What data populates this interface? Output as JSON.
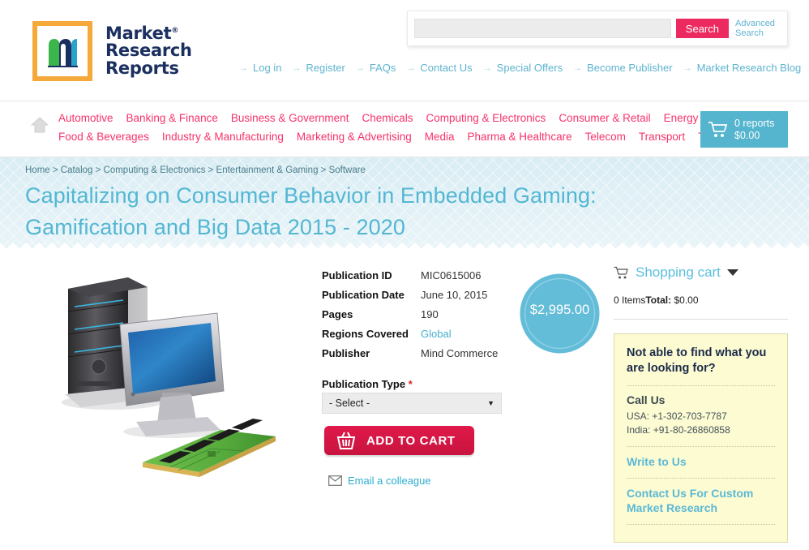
{
  "brand": {
    "logo_line1": "Market",
    "logo_line2": "Research",
    "logo_line3": "Reports",
    "registered_mark": "®",
    "logo_letter": "m",
    "colors": {
      "orange": "#f5a93a",
      "navy": "#1b3060",
      "green": "#3cb54a",
      "blue": "#29a3c9",
      "pink": "#ec2a5f",
      "teal": "#55b4ce"
    }
  },
  "search": {
    "value": "",
    "placeholder": "",
    "button_label": "Search",
    "advanced_label": "Advanced Search"
  },
  "toplinks": [
    {
      "label": "Log in"
    },
    {
      "label": "Register"
    },
    {
      "label": "FAQs"
    },
    {
      "label": "Contact Us"
    },
    {
      "label": "Special Offers"
    },
    {
      "label": "Become Publisher"
    },
    {
      "label": "Market Research Blog"
    }
  ],
  "nav": {
    "home_icon": "home-icon",
    "row1": [
      {
        "label": "Automotive"
      },
      {
        "label": "Banking & Finance"
      },
      {
        "label": "Business & Government"
      },
      {
        "label": "Chemicals"
      },
      {
        "label": "Computing & Electronics"
      },
      {
        "label": "Consumer & Retail"
      },
      {
        "label": "Energy & Utilities"
      }
    ],
    "row2": [
      {
        "label": "Food & Beverages"
      },
      {
        "label": "Industry & Manufacturing"
      },
      {
        "label": "Marketing & Advertising"
      },
      {
        "label": "Media"
      },
      {
        "label": "Pharma & Healthcare"
      },
      {
        "label": "Telecom"
      },
      {
        "label": "Transport"
      },
      {
        "label": "Travel & Leisure"
      }
    ]
  },
  "cart_widget": {
    "reports": "0 reports",
    "amount": "$0.00"
  },
  "banner": {
    "breadcrumb": "Home > Catalog > Computing & Electronics > Entertainment & Gaming > Software",
    "title": "Capitalizing on Consumer Behavior in Embedded Gaming: Gamification and Big Data 2015 - 2020"
  },
  "product": {
    "image_alt": "desktop-computer-monitor-memory-module"
  },
  "details": {
    "rows": [
      {
        "label": "Publication ID",
        "value": "MIC0615006",
        "is_link": false
      },
      {
        "label": "Publication Date",
        "value": "June 10, 2015",
        "is_link": false
      },
      {
        "label": "Pages",
        "value": "190",
        "is_link": false
      },
      {
        "label": "Regions Covered",
        "value": "Global",
        "is_link": true
      },
      {
        "label": "Publisher",
        "value": "Mind Commerce",
        "is_link": false
      }
    ]
  },
  "price_badge": {
    "amount": "$2,995.00"
  },
  "form": {
    "publication_type_label": "Publication Type",
    "required_mark": "*",
    "select_value": "- Select -",
    "select_options": [
      "- Select -"
    ],
    "add_to_cart_label": "ADD TO CART",
    "email_colleague_label": "Email a colleague"
  },
  "shopping_cart": {
    "title": "Shopping cart",
    "items_text": "0 Items",
    "total_label": "Total:",
    "total_value": "$0.00"
  },
  "help_box": {
    "title": "Not able to find what you are looking for?",
    "call_us": "Call Us",
    "phone_usa": "USA: +1-302-703-7787",
    "phone_india": "India: +91-80-26860858",
    "write_to_us": "Write to Us",
    "custom_research": "Contact Us For Custom Market Research"
  }
}
